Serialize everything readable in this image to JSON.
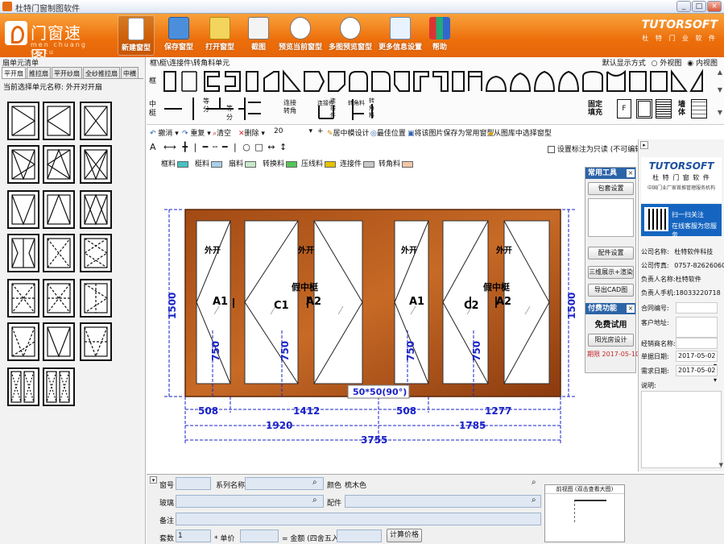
{
  "window": {
    "title": "杜特门窗制图软件",
    "buttons": [
      "_",
      "□",
      "×"
    ]
  },
  "ribbon": {
    "logo_cn": "门窗速图",
    "logo_pinyin": "men chuang su tu",
    "items": [
      {
        "label": "新建窗型",
        "icon": "new-doc-icon",
        "active": true
      },
      {
        "label": "保存窗型",
        "icon": "save-icon"
      },
      {
        "label": "打开窗型",
        "icon": "open-icon"
      },
      {
        "label": "截图",
        "icon": "screenshot-icon"
      },
      {
        "label": "预览当前窗型",
        "icon": "preview-icon"
      },
      {
        "label": "多图预览窗型",
        "icon": "multi-preview-icon"
      },
      {
        "label": "更多信息设置",
        "icon": "settings-edit-icon"
      },
      {
        "label": "帮助",
        "icon": "help-books-icon"
      }
    ],
    "brand": "TUTORSOFT",
    "brand_sub": "杜 特 门 业 软 件"
  },
  "left_panel": {
    "title": "扇单元清单",
    "tabs": [
      "平开扇",
      "推拉扇",
      "平开纱扇",
      "全纱推拉扇",
      "中横"
    ],
    "current_label": "当前选择单元名称: 外开对开扇"
  },
  "shape_strip": {
    "header": "框\\梃\\连接件\\转角料单元",
    "display_mode_label": "默认显示方式",
    "outer_view": "外视图",
    "inner_view": "内视图",
    "frame_label": "框",
    "mullion_label": "中梃",
    "mullion_items": [
      "等分",
      "等分",
      "连接转角",
      "连接件",
      "连接件",
      "转角料",
      "转角料"
    ],
    "fixed_fill_label": "固定填充",
    "fill_f": "F",
    "wall_label": "墙体"
  },
  "commands": {
    "undo": "撤消",
    "redo": "重复",
    "clear": "清空",
    "delete": "删除",
    "size": "20",
    "plus": "+",
    "center_design": "居中模设计",
    "best_position": "最佳位置",
    "save_common": "将该图片保存为常用窗型",
    "from_library": "从图库中选择窗型"
  },
  "draw_tools": {
    "text_tool": "A",
    "readonly_label": "设置标注为只读 (不可编辑)"
  },
  "legend": [
    {
      "label": "框料",
      "color": "#47c2c2"
    },
    {
      "label": "梃料",
      "color": "#a8d0e8"
    },
    {
      "label": "扇料",
      "color": "#c8e8c8"
    },
    {
      "label": "转换料",
      "color": "#55c455"
    },
    {
      "label": "压线料",
      "color": "#e6c200"
    },
    {
      "label": "连接件",
      "color": "#c8c8c8"
    },
    {
      "label": "转角料",
      "color": "#f3c7a8"
    }
  ],
  "drawing": {
    "sash_labels": [
      "外开",
      "外开",
      "外开",
      "外开"
    ],
    "fake_mullion": "假中梃",
    "panel_codes": [
      "A1",
      "C1",
      "A2",
      "A1",
      "C2",
      "A2"
    ],
    "height_total": "1500",
    "height_right": "1500",
    "sash_heights": [
      "750",
      "750",
      "750",
      "750"
    ],
    "widths_row1": [
      "508",
      "1412",
      "508",
      "1277"
    ],
    "widths_row2": [
      "1920",
      "1785"
    ],
    "width_total": "3755",
    "profile_label": "50*50(90°)"
  },
  "tool_panel": {
    "title": "常用工具",
    "close": "×",
    "buttons": [
      "包套设置",
      "配件设置",
      "三维展示+渲染",
      "导出CAD图"
    ],
    "paid_title": "付费功能",
    "free_trial": "免费试用",
    "sunroom": "阳光房设计",
    "expire": "期限 2017-05-10"
  },
  "right_panel": {
    "toggle": "▸",
    "logo": "TUTORSOFT",
    "logo_sub": "杜 特 门 窗 软 件",
    "tagline": "中国门业厂家首推管理服务机构",
    "qr_text1": "扫一扫关注",
    "qr_text2": "在线客服为您服务",
    "company_label": "公司名称:",
    "company": "杜特软件科技",
    "fax_label": "公司传真:",
    "fax": "0757-82626060",
    "manager_label": "负责人名称:",
    "manager": "杜特软件",
    "phone_label": "负责人手机:",
    "phone": "18033220718",
    "contract_label": "合同编号:",
    "address_label": "客户地址:",
    "dealer_label": "经销商名称:",
    "order_date_label": "单据日期:",
    "order_date": "2017-05-02",
    "need_date_label": "需求日期:",
    "need_date": "2017-05-02",
    "note_label": "说明:"
  },
  "bottom_form": {
    "window_no": "窗号",
    "series_name": "系列名称",
    "color_label": "颜色",
    "color_value": "梳木色",
    "glass": "玻璃",
    "fittings": "配件",
    "remark": "备注",
    "sets": "套数",
    "sets_value": "1",
    "unit_price": "* 单价",
    "total": "= 金额 (四舍五入)",
    "calc": "计算价格",
    "preview_title": "前视图 (双击查看大图)"
  }
}
